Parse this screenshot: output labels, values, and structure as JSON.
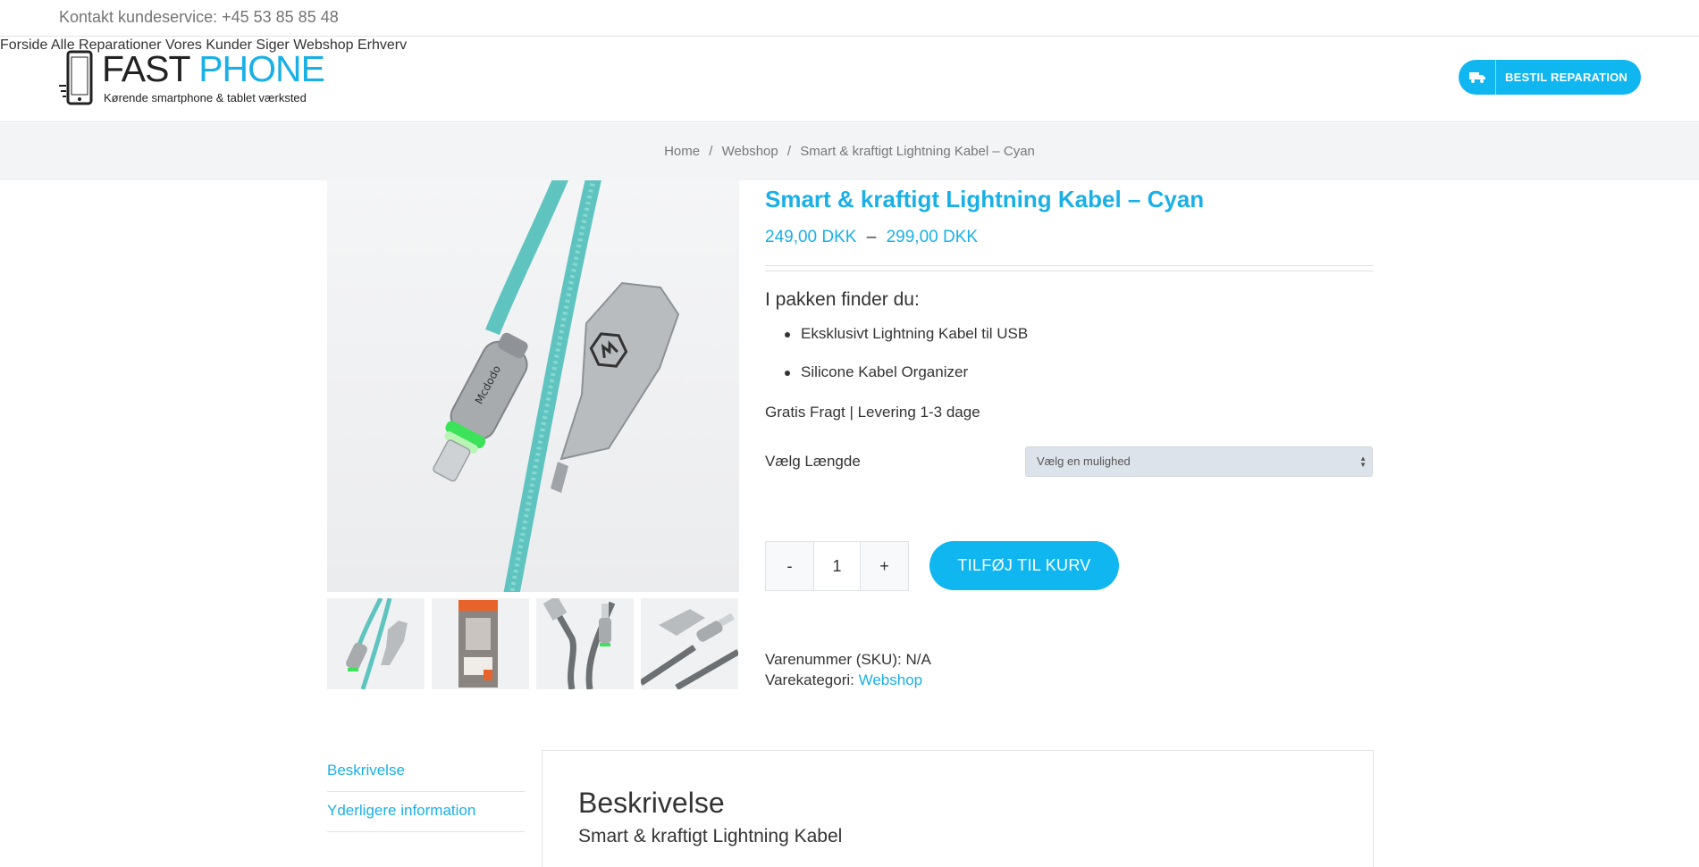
{
  "topbar": {
    "contact": "Kontakt kundeservice: +45 53 85 85 48"
  },
  "logo": {
    "brand_fast": "FAST",
    "brand_phone": "PHONE",
    "tagline": "Kørende smartphone & tablet værksted"
  },
  "nav": {
    "items": [
      "Forside",
      "Alle Reparationer",
      "Vores Kunder Siger",
      "Webshop",
      "Erhverv"
    ],
    "cta_label": "BESTIL REPARATION"
  },
  "breadcrumb": {
    "home": "Home",
    "shop": "Webshop",
    "current": "Smart & kraftigt Lightning Kabel – Cyan",
    "separator": "/"
  },
  "product": {
    "title": "Smart & kraftigt Lightning Kabel – Cyan",
    "price_min": "249,00 DKK",
    "price_sep": "–",
    "price_max": "299,00 DKK",
    "package_heading": "I pakken finder du:",
    "package_items": [
      "Eksklusivt Lightning Kabel til USB",
      "Silicone Kabel Organizer"
    ],
    "shipping": "Gratis Fragt | Levering 1-3 dage",
    "variation_label": "Vælg Længde",
    "variation_placeholder": "Vælg en mulighed",
    "qty_minus": "-",
    "qty_value": "1",
    "qty_plus": "+",
    "add_to_cart": "TILFØJ TIL KURV",
    "sku_label": "Varenummer (SKU): N/A",
    "category_label": "Varekategori:",
    "category_link": "Webshop",
    "cable_brand": "Mcdodo"
  },
  "tabs": {
    "items": [
      "Beskrivelse",
      "Yderligere information"
    ],
    "panel_heading": "Beskrivelse",
    "panel_subheading": "Smart & kraftigt Lightning Kabel"
  },
  "colors": {
    "accent": "#1ab0e6",
    "button": "#0fb6ef",
    "cable": "#5fc4c0",
    "led": "#3ce25a"
  }
}
